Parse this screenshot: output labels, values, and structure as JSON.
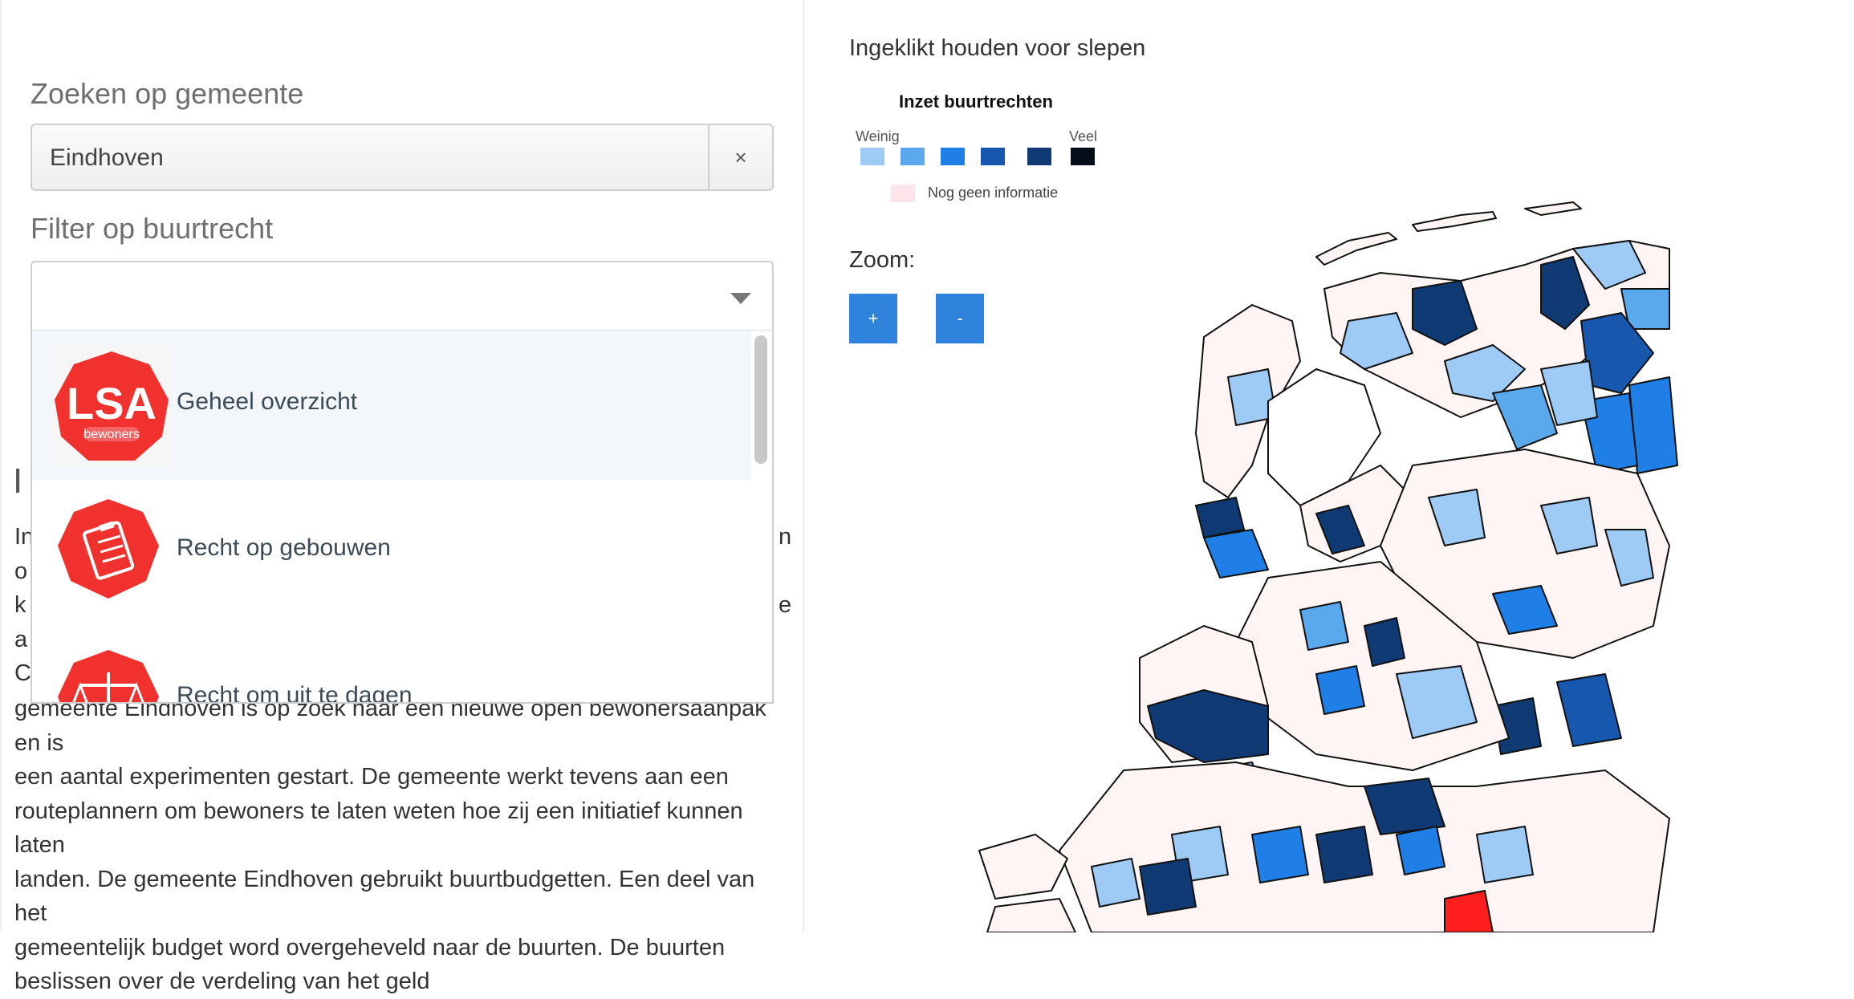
{
  "search": {
    "label": "Zoeken op gemeente",
    "value": "Eindhoven",
    "clear_symbol": "×"
  },
  "filter": {
    "label": "Filter op buurtrecht",
    "options": [
      {
        "label": "Geheel overzicht",
        "icon": "lsa-bewoners-logo-icon",
        "logo_text_main": "LSA",
        "logo_text_sub": "bewoners"
      },
      {
        "label": "Recht op gebouwen",
        "icon": "clipboard-checklist-icon"
      },
      {
        "label": "Recht om uit te dagen",
        "icon": "scales-icon"
      }
    ]
  },
  "article": {
    "heading_fragment": "I",
    "side_left": [
      "In",
      "o",
      "k",
      "a",
      "C"
    ],
    "side_right": [
      "n",
      "e"
    ],
    "lines": [
      "gemeente Eindhoven is op zoek naar een nieuwe open bewonersaanpak en is",
      "een aantal experimenten gestart. De gemeente werkt tevens aan een",
      "routeplannern om bewoners te laten weten hoe zij een initiatief kunnen laten",
      "landen. De gemeente Eindhoven gebruikt buurtbudgetten. Een deel van het",
      "gemeentelijk budget word overgeheveld naar de buurten. De buurten",
      "beslissen over de verdeling van het geld"
    ]
  },
  "map": {
    "drag_hint": "Ingeklikt houden voor slepen",
    "zoom_label": "Zoom:",
    "zoom_in": "+",
    "zoom_out": "-",
    "legend": {
      "title": "Inzet buurtrechten",
      "low": "Weinig",
      "high": "Veel",
      "no_info": "Nog geen informatie",
      "colors": [
        "#9ecbf5",
        "#5aa9ec",
        "#1f7fe6",
        "#1757ad",
        "#103a73",
        "#050d1a"
      ],
      "no_info_color": "#fde3ea",
      "highlight_color": "#ff1e1e"
    }
  }
}
